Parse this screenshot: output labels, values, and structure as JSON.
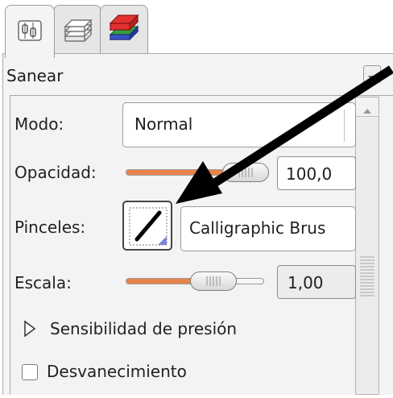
{
  "panel": {
    "title": "Sanear"
  },
  "tabs": [
    {
      "name": "tool-options",
      "icon": "tool-options-icon",
      "active": true
    },
    {
      "name": "layers",
      "icon": "layers-icon",
      "active": false
    },
    {
      "name": "channels",
      "icon": "channels-icon",
      "active": false
    }
  ],
  "controls": {
    "mode": {
      "label": "Modo:",
      "value": "Normal"
    },
    "opacity": {
      "label": "Opacidad:",
      "value": "100,0",
      "level": 1.0,
      "track_color": "#e8834a"
    },
    "brushes": {
      "label": "Pinceles:",
      "value": "Calligraphic Brus"
    },
    "scale": {
      "label": "Escala:",
      "value": "1,00",
      "level": 0.5,
      "track_color": "#e8834a"
    },
    "pressure": {
      "label": "Sensibilidad de presión",
      "expanded": false
    },
    "fade": {
      "label": "Desvanecimiento",
      "checked": false
    }
  },
  "annotation": {
    "type": "arrow",
    "color": "#000000",
    "icon": "arrow-annotation-icon"
  }
}
